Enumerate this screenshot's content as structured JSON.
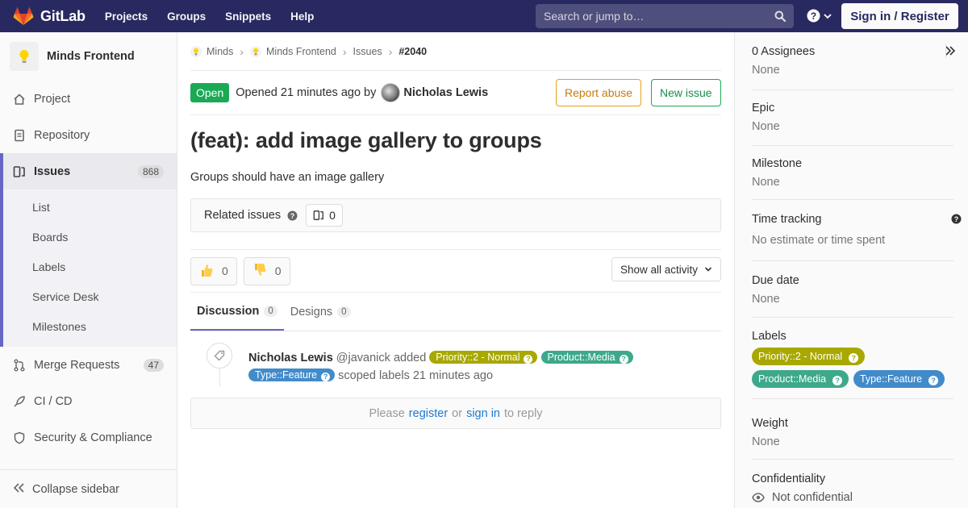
{
  "topnav": {
    "brand": "GitLab",
    "links": [
      "Projects",
      "Groups",
      "Snippets",
      "Help"
    ],
    "search_placeholder": "Search or jump to…",
    "signin_label": "Sign in / Register",
    "brand_color": "#292961"
  },
  "sidebar": {
    "project_name": "Minds Frontend",
    "items": [
      {
        "label": "Project",
        "icon": "home-icon"
      },
      {
        "label": "Repository",
        "icon": "document-icon"
      },
      {
        "label": "Issues",
        "icon": "issues-icon",
        "count": "868",
        "active": true
      },
      {
        "label": "Merge Requests",
        "icon": "merge-request-icon",
        "count": "47"
      },
      {
        "label": "CI / CD",
        "icon": "rocket-icon"
      },
      {
        "label": "Security & Compliance",
        "icon": "shield-icon"
      }
    ],
    "issues_sub": [
      "List",
      "Boards",
      "Labels",
      "Service Desk",
      "Milestones"
    ],
    "collapse_label": "Collapse sidebar"
  },
  "breadcrumb": {
    "items": [
      "Minds",
      "Minds Frontend",
      "Issues"
    ],
    "current": "#2040"
  },
  "issue": {
    "status": "Open",
    "opened_text": "Opened 21 minutes ago by",
    "author": "Nicholas Lewis",
    "report_abuse": "Report abuse",
    "new_issue": "New issue",
    "title": "(feat): add image gallery to groups",
    "description": "Groups should have an image gallery"
  },
  "related": {
    "label": "Related issues",
    "count": "0"
  },
  "awards": {
    "thumbs_up": "0",
    "thumbs_down": "0",
    "activity_filter": "Show all activity"
  },
  "tabs": [
    {
      "label": "Discussion",
      "count": "0",
      "active": true
    },
    {
      "label": "Designs",
      "count": "0"
    }
  ],
  "note": {
    "author": "Nicholas Lewis",
    "handle": "@javanick",
    "action": "added",
    "labels": [
      "Priority::2 - Normal",
      "Product::Media",
      "Type::Feature"
    ],
    "suffix": "scoped labels 21 minutes ago"
  },
  "reply": {
    "please": "Please",
    "register": "register",
    "or": "or",
    "sign_in": "sign in",
    "to_reply": "to reply"
  },
  "right_sidebar": {
    "assignees_title": "0 Assignees",
    "assignees_value": "None",
    "epic_title": "Epic",
    "epic_value": "None",
    "milestone_title": "Milestone",
    "milestone_value": "None",
    "time_title": "Time tracking",
    "time_value": "No estimate or time spent",
    "due_title": "Due date",
    "due_value": "None",
    "labels_title": "Labels",
    "labels": [
      {
        "text": "Priority::2 - Normal",
        "color": "#a8a800"
      },
      {
        "text": "Product::Media",
        "color": "#3da98a"
      },
      {
        "text": "Type::Feature",
        "color": "#428bca"
      }
    ],
    "weight_title": "Weight",
    "weight_value": "None",
    "confidentiality_title": "Confidentiality",
    "confidentiality_value": "Not confidential"
  }
}
